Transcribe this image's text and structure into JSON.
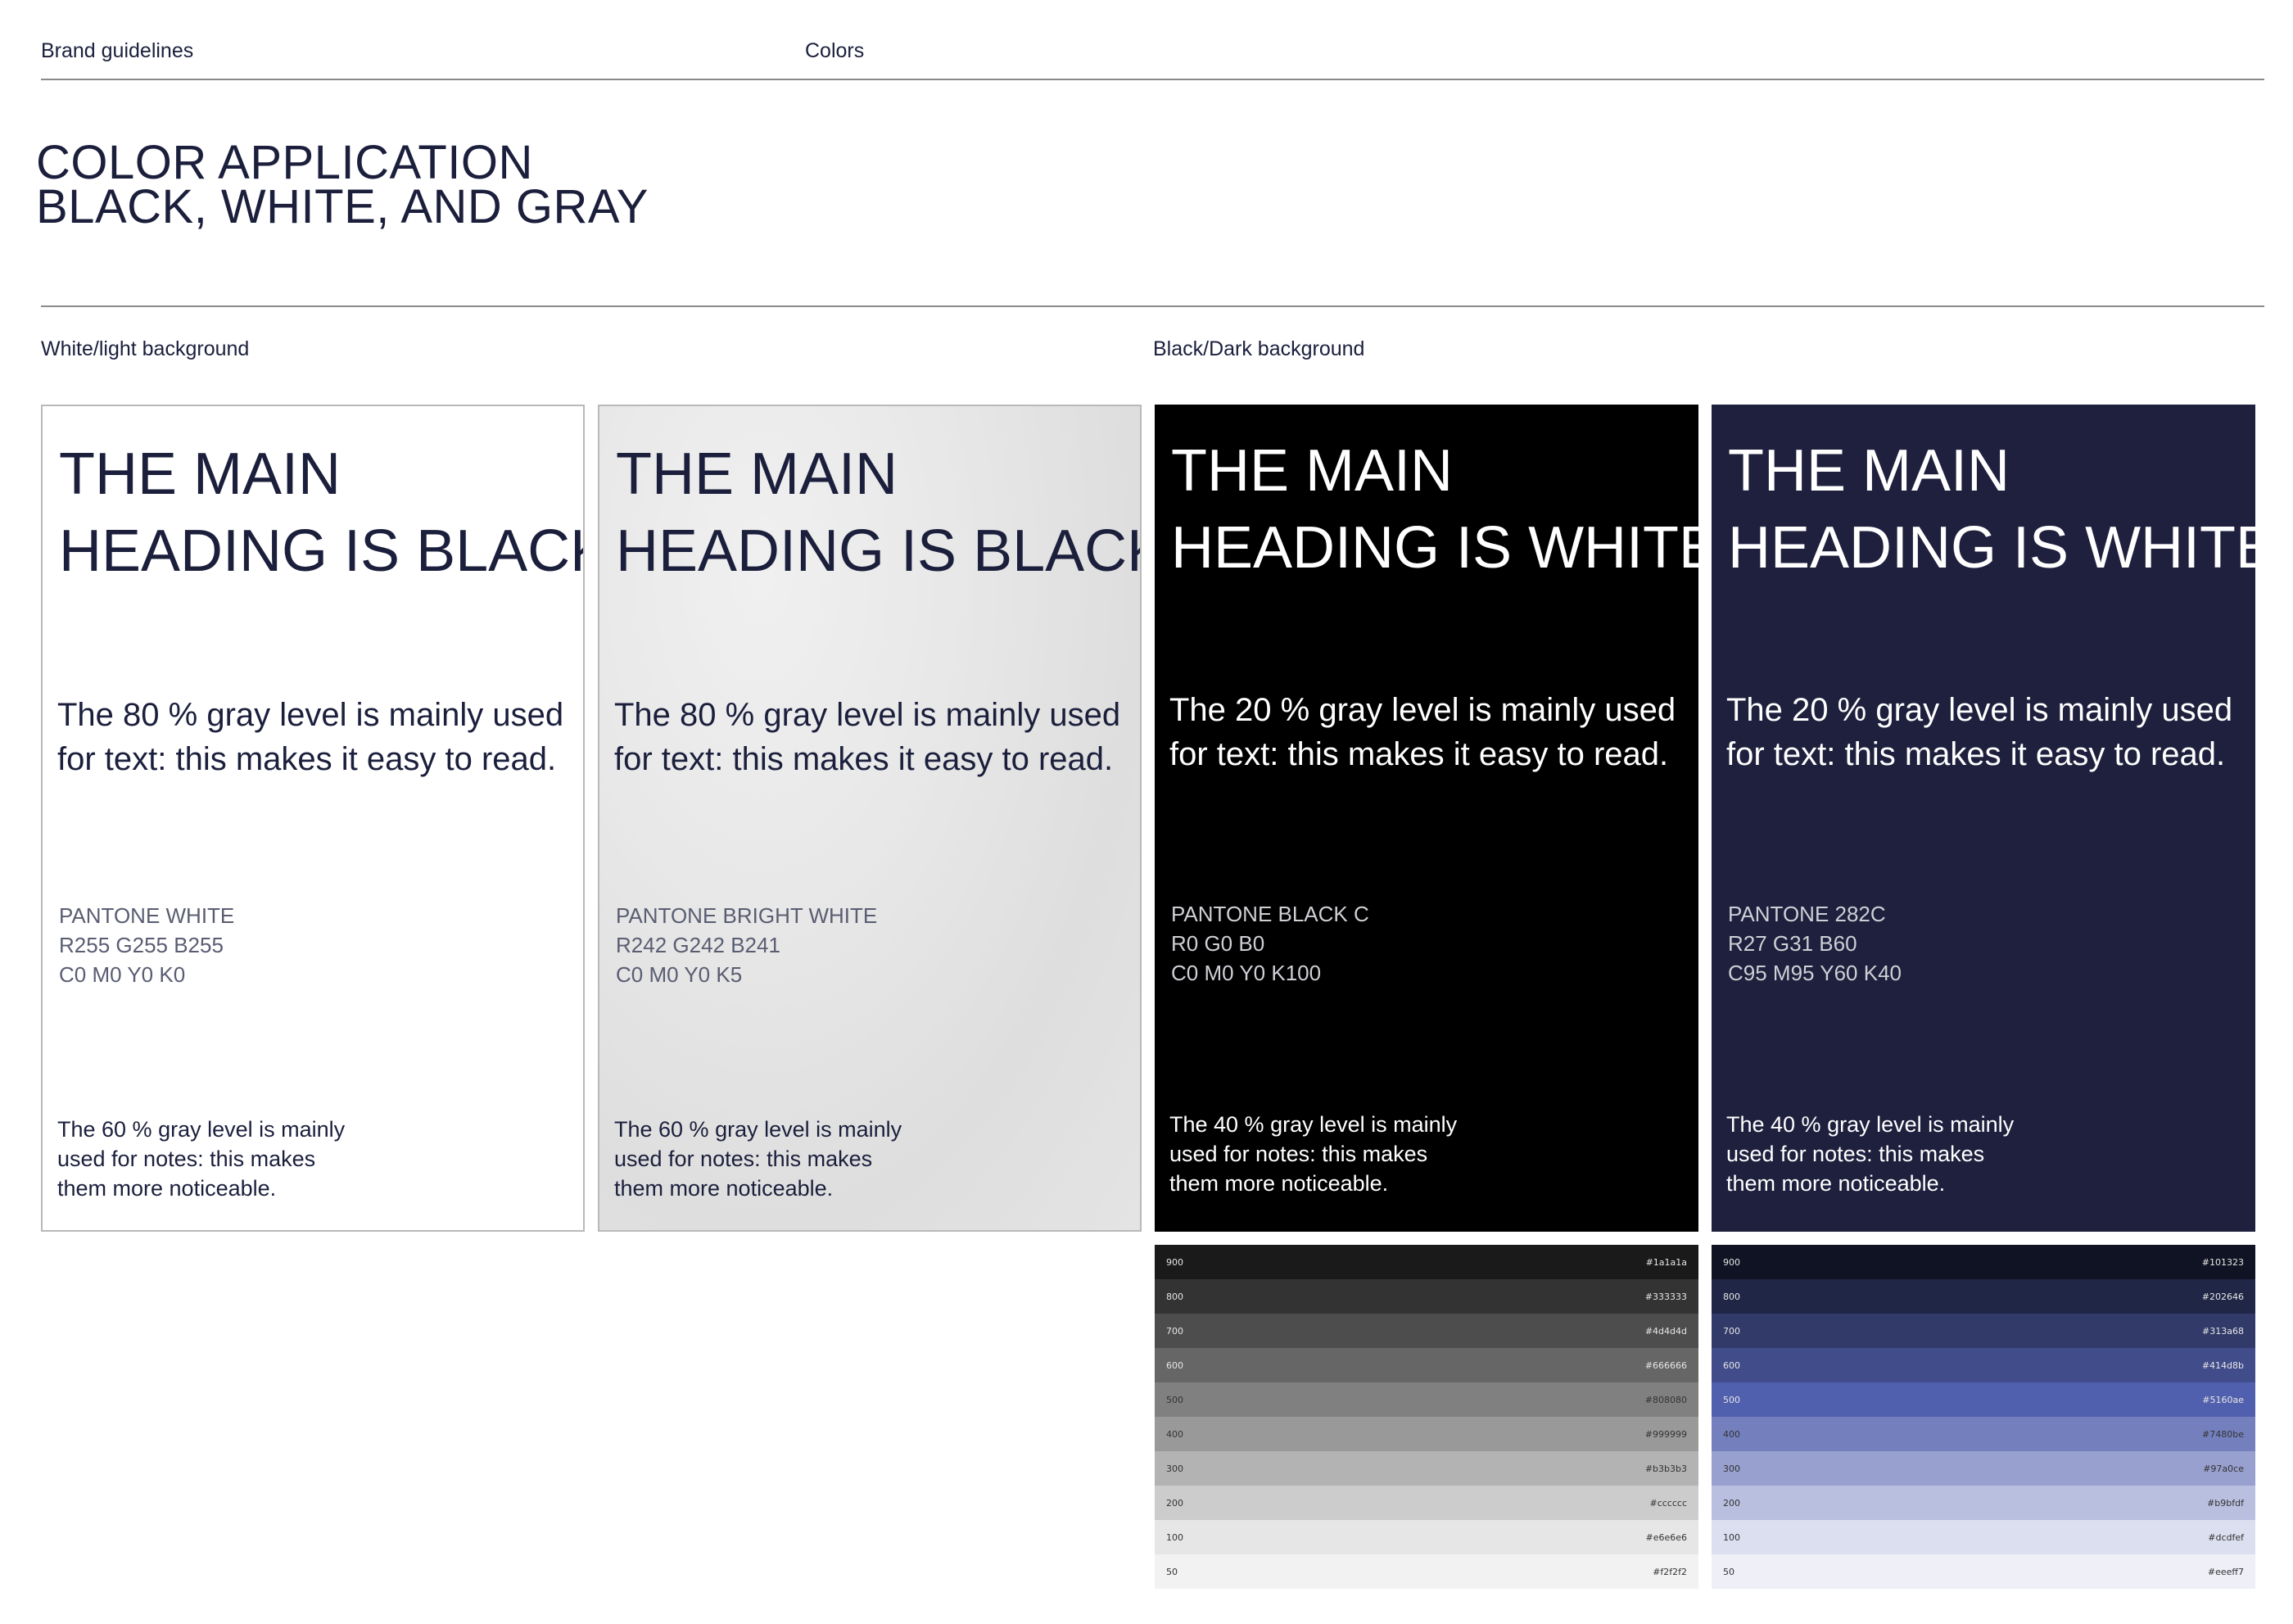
{
  "header": {
    "brand": "Brand guidelines",
    "section": "Colors"
  },
  "title": {
    "line1": "COLOR APPLICATION",
    "line2": "BLACK, WHITE, AND GRAY"
  },
  "labels": {
    "light": "White/light background",
    "dark": "Black/Dark background"
  },
  "cards": [
    {
      "heading1": "THE MAIN",
      "heading2": "HEADING IS BLACK",
      "body1": "The 80 % gray level is mainly used",
      "body2": "for text: this makes it easy to read.",
      "pantone1": "PANTONE WHITE",
      "pantone2": "R255 G255 B255",
      "pantone3": "C0 M0 Y0 K0",
      "note1": "The 60 % gray level is mainly",
      "note2": "used for notes: this makes",
      "note3": "them more noticeable.",
      "background": "#ffffff"
    },
    {
      "heading1": "THE MAIN",
      "heading2": "HEADING IS BLACK",
      "body1": "The 80 % gray level is mainly used",
      "body2": "for text: this makes it easy to read.",
      "pantone1": "PANTONE BRIGHT WHITE",
      "pantone2": "R242 G242 B241",
      "pantone3": "C0 M0 Y0 K5",
      "note1": "The 60 % gray level is mainly",
      "note2": "used for notes: this makes",
      "note3": "them more noticeable.",
      "background": "#f2f2f1"
    },
    {
      "heading1": "THE MAIN",
      "heading2": "HEADING IS WHITE",
      "body1": "The 20 % gray level is mainly used",
      "body2": "for text: this makes it easy to read.",
      "pantone1": "PANTONE BLACK C",
      "pantone2": "R0 G0 B0",
      "pantone3": "C0 M0 Y0 K100",
      "note1": "The 40 % gray level is mainly",
      "note2": "used for notes: this makes",
      "note3": "them more noticeable.",
      "background": "#000000"
    },
    {
      "heading1": "THE MAIN",
      "heading2": "HEADING IS WHITE",
      "body1": "The 20 % gray level is mainly used",
      "body2": "for text: this makes it easy to read.",
      "pantone1": "PANTONE 282C",
      "pantone2": "R27 G31 B60",
      "pantone3": "C95 M95 Y60 K40",
      "note1": "The 40 % gray level is mainly",
      "note2": "used for notes: this makes",
      "note3": "them more noticeable.",
      "background": "#1b1f3c"
    }
  ],
  "palettes": {
    "gray": [
      {
        "level": "900",
        "hex": "#1a1a1a"
      },
      {
        "level": "800",
        "hex": "#333333"
      },
      {
        "level": "700",
        "hex": "#4d4d4d"
      },
      {
        "level": "600",
        "hex": "#666666"
      },
      {
        "level": "500",
        "hex": "#808080"
      },
      {
        "level": "400",
        "hex": "#999999"
      },
      {
        "level": "300",
        "hex": "#b3b3b3"
      },
      {
        "level": "200",
        "hex": "#cccccc"
      },
      {
        "level": "100",
        "hex": "#e6e6e6"
      },
      {
        "level": "50",
        "hex": "#f2f2f2"
      }
    ],
    "navy": [
      {
        "level": "900",
        "hex": "#101323"
      },
      {
        "level": "800",
        "hex": "#202646"
      },
      {
        "level": "700",
        "hex": "#313a68"
      },
      {
        "level": "600",
        "hex": "#414d8b"
      },
      {
        "level": "500",
        "hex": "#5160ae"
      },
      {
        "level": "400",
        "hex": "#7480be"
      },
      {
        "level": "300",
        "hex": "#97a0ce"
      },
      {
        "level": "200",
        "hex": "#b9bfdf"
      },
      {
        "level": "100",
        "hex": "#dcdfef"
      },
      {
        "level": "50",
        "hex": "#eeeff7"
      }
    ]
  }
}
